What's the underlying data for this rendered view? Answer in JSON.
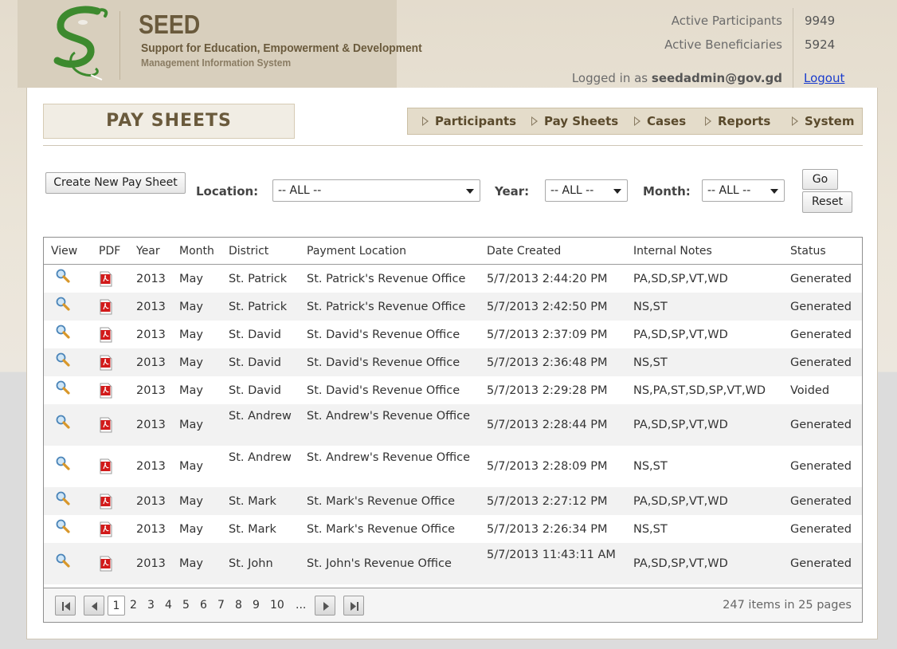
{
  "brand": {
    "name": "SEED",
    "tagline": "Support for Education, Empowerment & Development",
    "subtitle": "Management Information System"
  },
  "stats": {
    "participants_label": "Active Participants",
    "participants_value": "9949",
    "beneficiaries_label": "Active Beneficiaries",
    "beneficiaries_value": "5924"
  },
  "session": {
    "logged_in_prefix": "Logged in as",
    "user": "seedadmin@gov.gd",
    "logout": "Logout"
  },
  "page_title": "PAY SHEETS",
  "nav": [
    "Participants",
    "Pay Sheets",
    "Cases",
    "Reports",
    "System"
  ],
  "filters": {
    "create_button": "Create New Pay Sheet",
    "location_label": "Location:",
    "location_value": "-- ALL --",
    "year_label": "Year:",
    "year_value": "-- ALL --",
    "month_label": "Month:",
    "month_value": "-- ALL --",
    "go_button": "Go",
    "reset_button": "Reset"
  },
  "grid": {
    "columns": [
      "View",
      "PDF",
      "Year",
      "Month",
      "District",
      "Payment Location",
      "Date Created",
      "Internal Notes",
      "Status"
    ],
    "rows": [
      {
        "year": "2013",
        "month": "May",
        "district": "St. Patrick",
        "location": "St. Patrick's Revenue Office",
        "date": "5/7/2013 2:44:20 PM",
        "notes": "PA,SD,SP,VT,WD",
        "status": "Generated"
      },
      {
        "year": "2013",
        "month": "May",
        "district": "St. Patrick",
        "location": "St. Patrick's Revenue Office",
        "date": "5/7/2013 2:42:50 PM",
        "notes": "NS,ST",
        "status": "Generated"
      },
      {
        "year": "2013",
        "month": "May",
        "district": "St. David",
        "location": "St. David's Revenue Office",
        "date": "5/7/2013 2:37:09 PM",
        "notes": "PA,SD,SP,VT,WD",
        "status": "Generated"
      },
      {
        "year": "2013",
        "month": "May",
        "district": "St. David",
        "location": "St. David's Revenue Office",
        "date": "5/7/2013 2:36:48 PM",
        "notes": "NS,ST",
        "status": "Generated"
      },
      {
        "year": "2013",
        "month": "May",
        "district": "St. David",
        "location": "St. David's Revenue Office",
        "date": "5/7/2013 2:29:28 PM",
        "notes": "NS,PA,ST,SD,SP,VT,WD",
        "status": "Voided"
      },
      {
        "year": "2013",
        "month": "May",
        "district": "St. Andrew",
        "location": "St. Andrew's Revenue Office",
        "date": "5/7/2013 2:28:44 PM",
        "notes": "PA,SD,SP,VT,WD",
        "status": "Generated"
      },
      {
        "year": "2013",
        "month": "May",
        "district": "St. Andrew",
        "location": "St. Andrew's Revenue Office",
        "date": "5/7/2013 2:28:09 PM",
        "notes": "NS,ST",
        "status": "Generated"
      },
      {
        "year": "2013",
        "month": "May",
        "district": "St. Mark",
        "location": "St. Mark's Revenue Office",
        "date": "5/7/2013 2:27:12 PM",
        "notes": "PA,SD,SP,VT,WD",
        "status": "Generated"
      },
      {
        "year": "2013",
        "month": "May",
        "district": "St. Mark",
        "location": "St. Mark's Revenue Office",
        "date": "5/7/2013 2:26:34 PM",
        "notes": "NS,ST",
        "status": "Generated"
      },
      {
        "year": "2013",
        "month": "May",
        "district": "St. John",
        "location": "St. John's Revenue Office",
        "date": "5/7/2013 11:43:11 AM",
        "notes": "PA,SD,SP,VT,WD",
        "status": "Generated"
      }
    ]
  },
  "pager": {
    "pages": [
      "1",
      "2",
      "3",
      "4",
      "5",
      "6",
      "7",
      "8",
      "9",
      "10",
      "..."
    ],
    "current": "1",
    "info": "247 items in 25 pages"
  },
  "colors": {
    "brand_brown": "#6a5a3c",
    "logo_green": "#3d8a2e",
    "link_blue": "#1a3ccd",
    "pdf_red": "#d21a1a"
  },
  "icons": {
    "view": "magnifier-icon",
    "pdf": "pdf-icon"
  }
}
